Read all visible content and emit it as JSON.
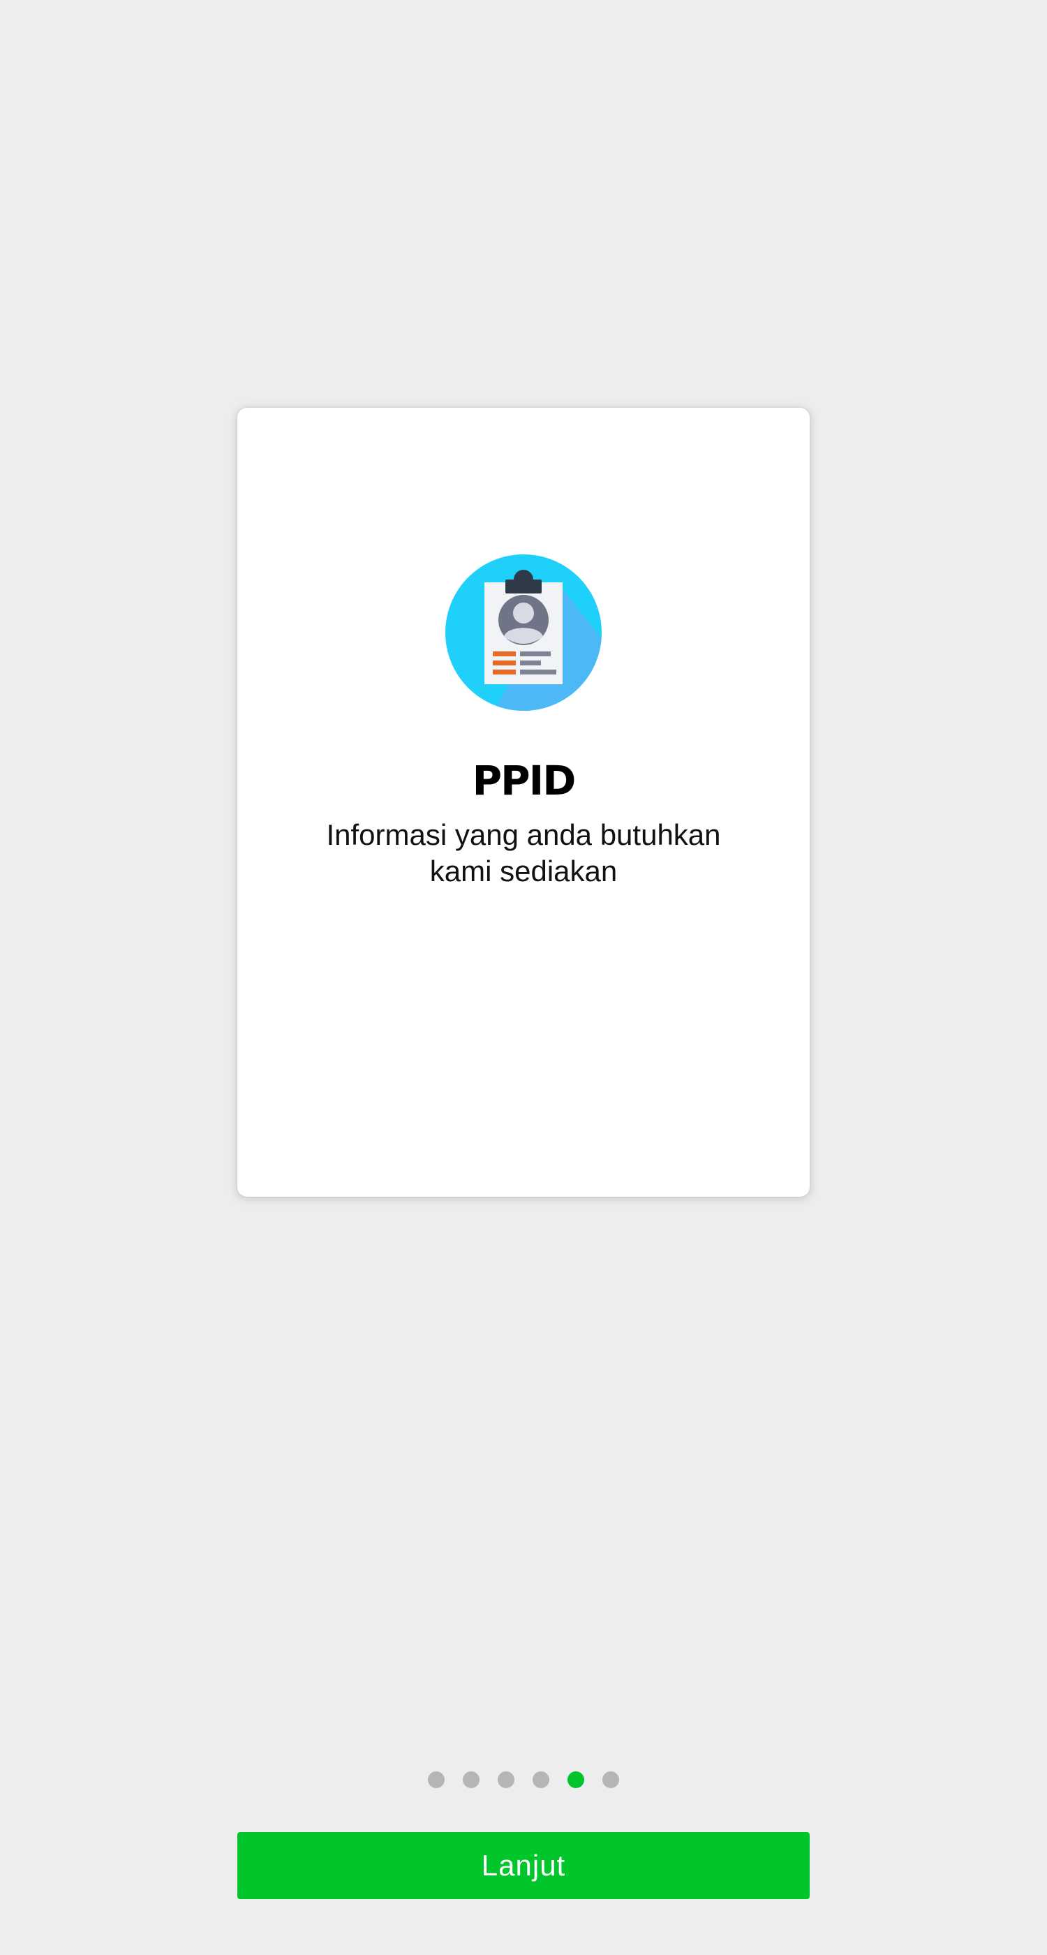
{
  "onboarding": {
    "title": "PPID",
    "subtitle": "Informasi yang anda butuhkan\nkami sediakan",
    "illustration_icon": "id-card-clipboard-icon"
  },
  "pager": {
    "total_pages": 6,
    "active_index": 4
  },
  "next_button": {
    "label": "Lanjut"
  },
  "colors": {
    "background": "#ededed",
    "card": "#ffffff",
    "accent": "#00c62c",
    "dot_inactive": "#b5b5b5",
    "icon_circle": "#1fd0fb",
    "icon_shade": "#4db8f6"
  }
}
